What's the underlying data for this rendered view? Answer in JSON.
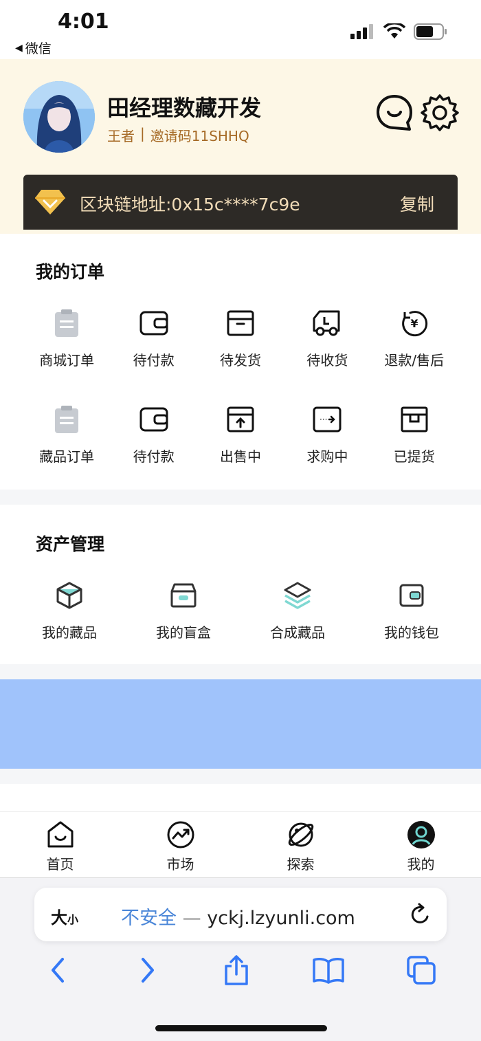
{
  "status_bar": {
    "time": "4:01",
    "back_app": "微信"
  },
  "profile": {
    "name": "田经理数藏开发",
    "level": "王者",
    "separator": "|",
    "invite": "邀请码11SHHQ",
    "chain_address": "区块链地址:0x15c****7c9e",
    "copy_label": "复制"
  },
  "orders": {
    "title": "我的订单",
    "row1": [
      "商城订单",
      "待付款",
      "待发货",
      "待收货",
      "退款/售后"
    ],
    "row2": [
      "藏品订单",
      "待付款",
      "出售中",
      "求购中",
      "已提货"
    ]
  },
  "assets": {
    "title": "资产管理",
    "items": [
      "我的藏品",
      "我的盲盒",
      "合成藏品",
      "我的钱包"
    ]
  },
  "tabbar": {
    "items": [
      "首页",
      "市场",
      "探索",
      "我的"
    ]
  },
  "safari": {
    "text_size": "大",
    "text_size_small": "小",
    "insecure": "不安全",
    "dash": "—",
    "domain": "yckj.lzyunli.com"
  },
  "colors": {
    "header_bg": "#fdf7e6",
    "chain_bar": "#2d2a26",
    "gold_text": "#f1dcb8",
    "banner": "#a0c3fb",
    "accent_blue": "#4a86d8"
  }
}
